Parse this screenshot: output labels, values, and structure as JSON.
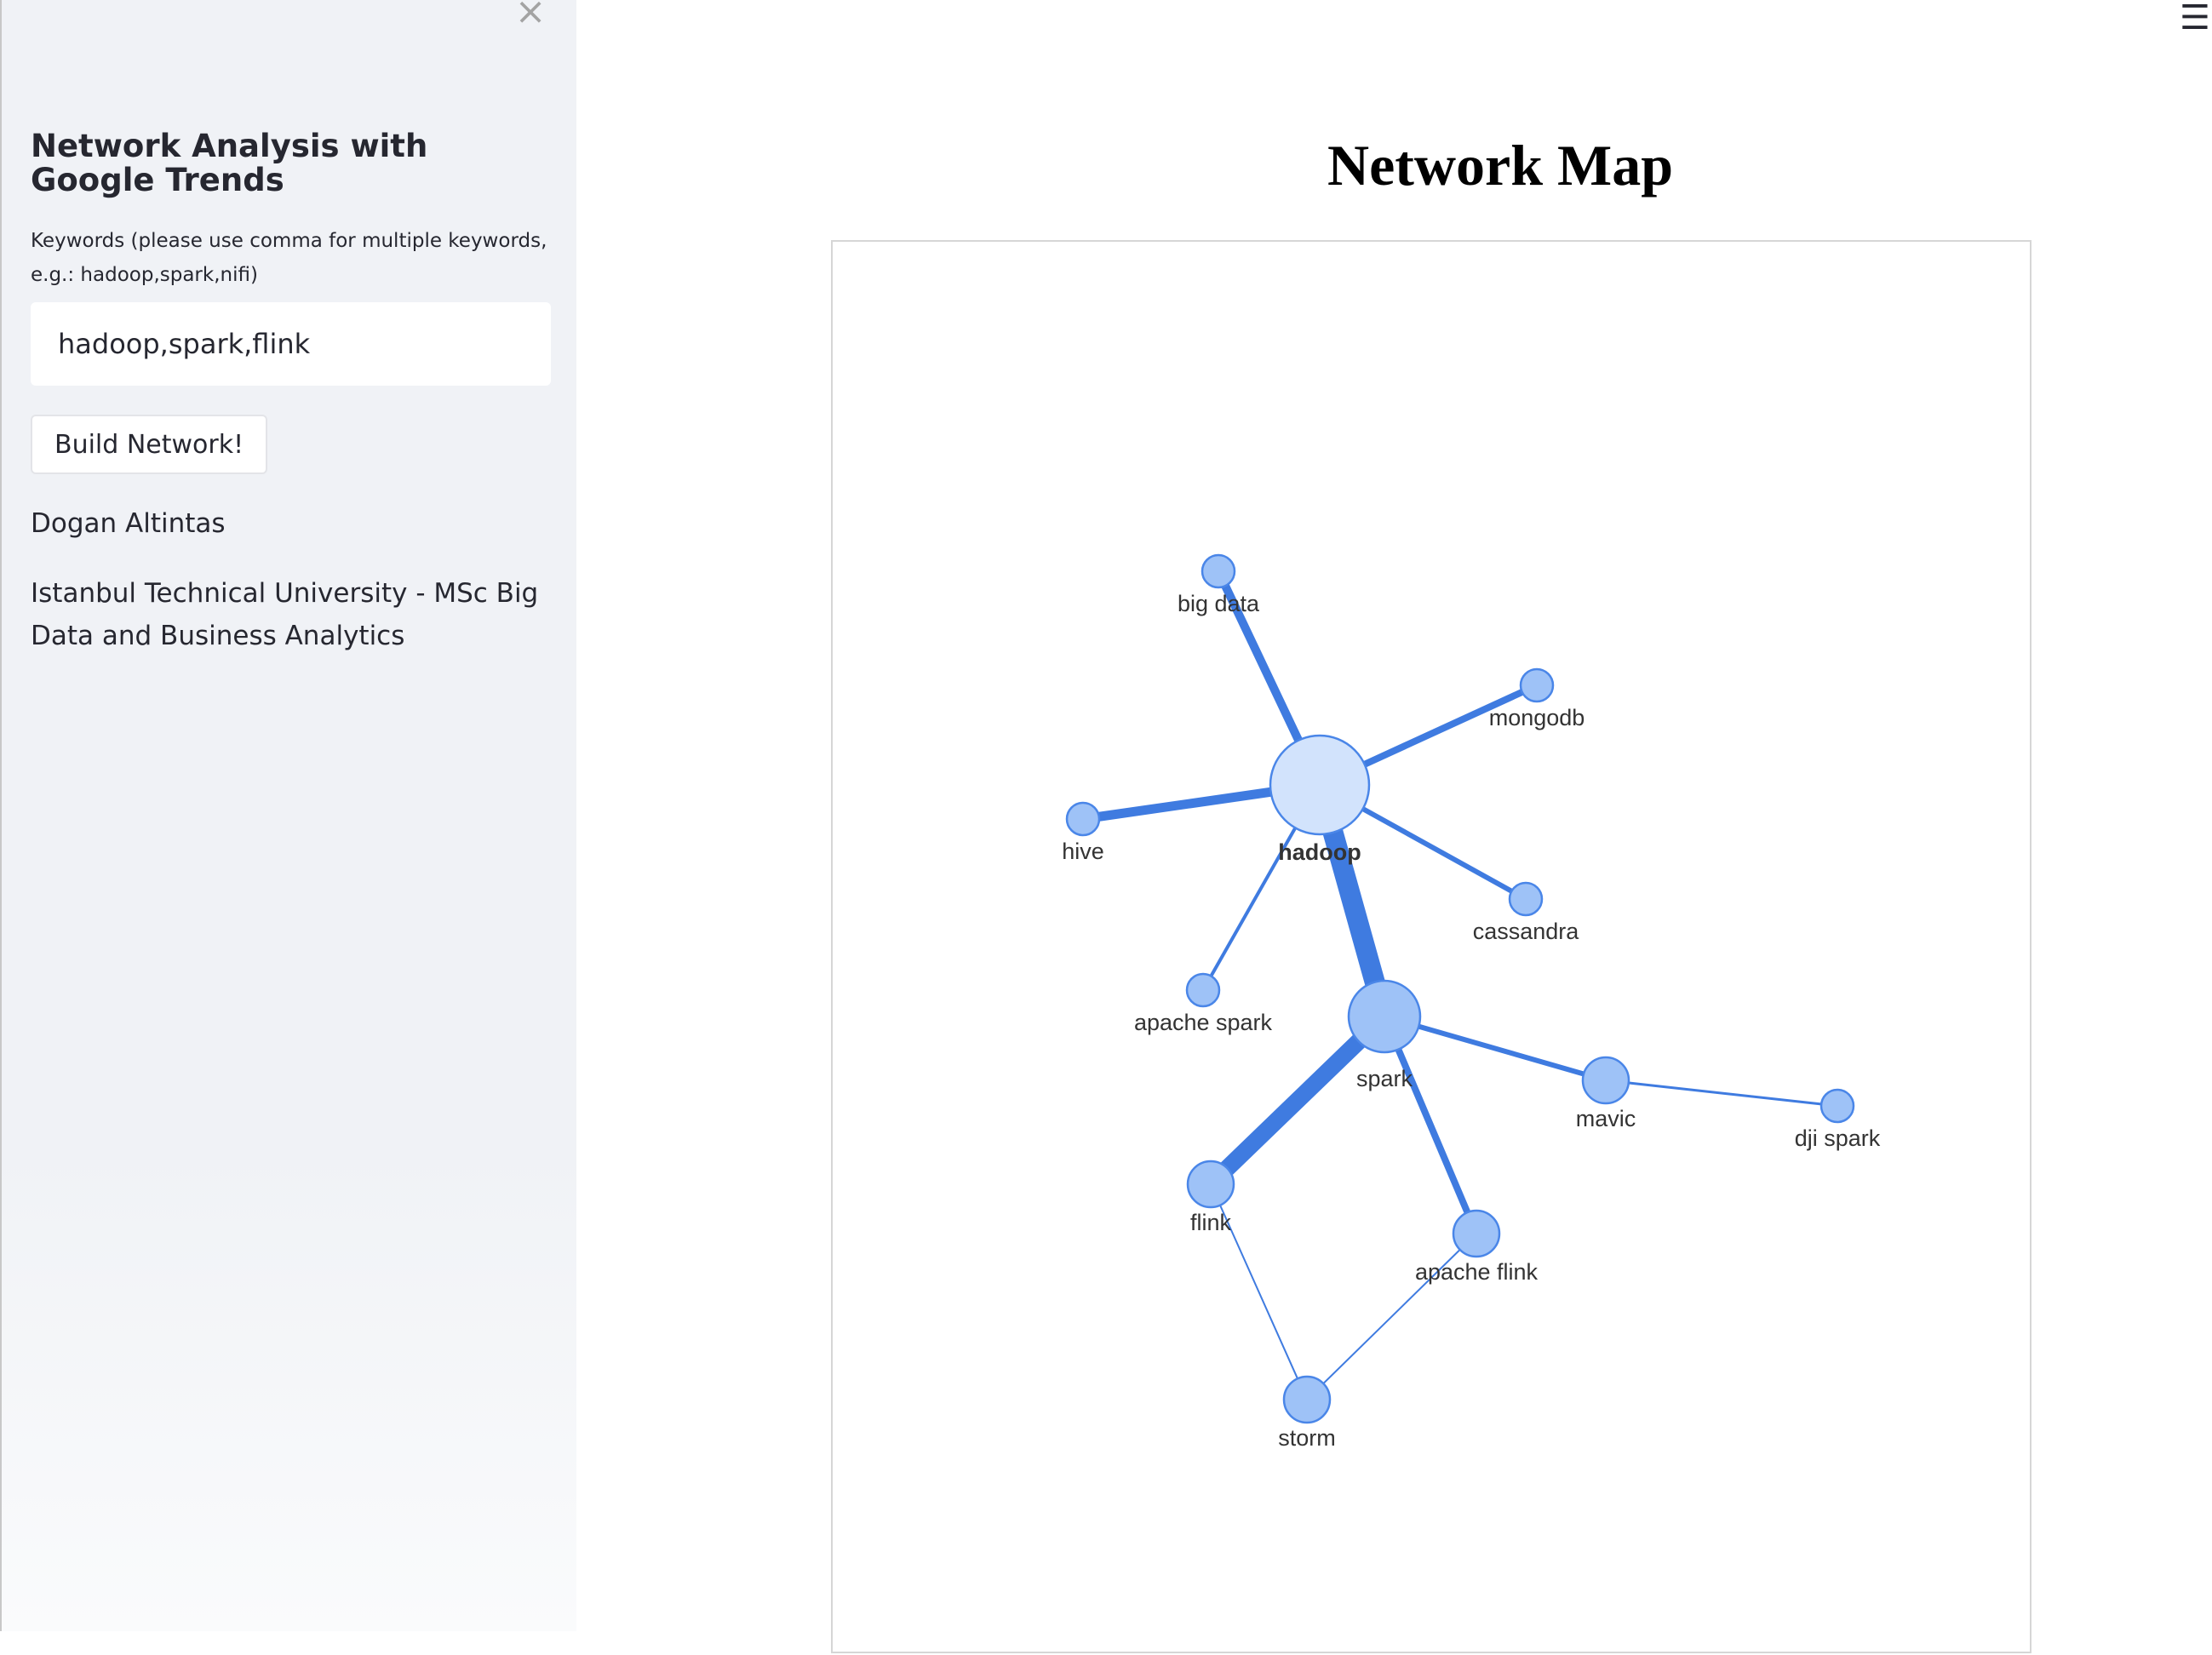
{
  "sidebar": {
    "close_glyph": "×",
    "title": "Network Analysis with Google Trends",
    "help_text": "Keywords (please use comma for multiple keywords, e.g.: hadoop,spark,nifi)",
    "keywords_value": "hadoop,spark,flink",
    "build_button_label": "Build Network!",
    "author": "Dogan Altintas",
    "affiliation": "Istanbul Technical University - MSc Big Data and Business Analytics"
  },
  "header": {
    "menu_glyph": "☰"
  },
  "main": {
    "title": "Network Map"
  },
  "colors": {
    "edge": "#3f7be0",
    "node_fill": "#9ec2f7",
    "node_stroke": "#4a86e8",
    "selected_node_fill": "#d2e3fc"
  },
  "network": {
    "nodes": [
      {
        "id": "hadoop",
        "label": "hadoop",
        "selected": true
      },
      {
        "id": "spark",
        "label": "spark"
      },
      {
        "id": "big data",
        "label": "big data"
      },
      {
        "id": "mongodb",
        "label": "mongodb"
      },
      {
        "id": "hive",
        "label": "hive"
      },
      {
        "id": "cassandra",
        "label": "cassandra"
      },
      {
        "id": "apache spark",
        "label": "apache spark"
      },
      {
        "id": "mavic",
        "label": "mavic"
      },
      {
        "id": "dji spark",
        "label": "dji spark"
      },
      {
        "id": "flink",
        "label": "flink"
      },
      {
        "id": "apache flink",
        "label": "apache flink"
      },
      {
        "id": "storm",
        "label": "storm"
      }
    ],
    "edges": [
      {
        "source": "hadoop",
        "target": "big data"
      },
      {
        "source": "hadoop",
        "target": "mongodb"
      },
      {
        "source": "hadoop",
        "target": "hive"
      },
      {
        "source": "hadoop",
        "target": "cassandra"
      },
      {
        "source": "hadoop",
        "target": "apache spark"
      },
      {
        "source": "hadoop",
        "target": "spark"
      },
      {
        "source": "spark",
        "target": "mavic"
      },
      {
        "source": "mavic",
        "target": "dji spark"
      },
      {
        "source": "spark",
        "target": "flink"
      },
      {
        "source": "spark",
        "target": "apache flink"
      },
      {
        "source": "flink",
        "target": "storm"
      },
      {
        "source": "apache flink",
        "target": "storm"
      }
    ]
  }
}
